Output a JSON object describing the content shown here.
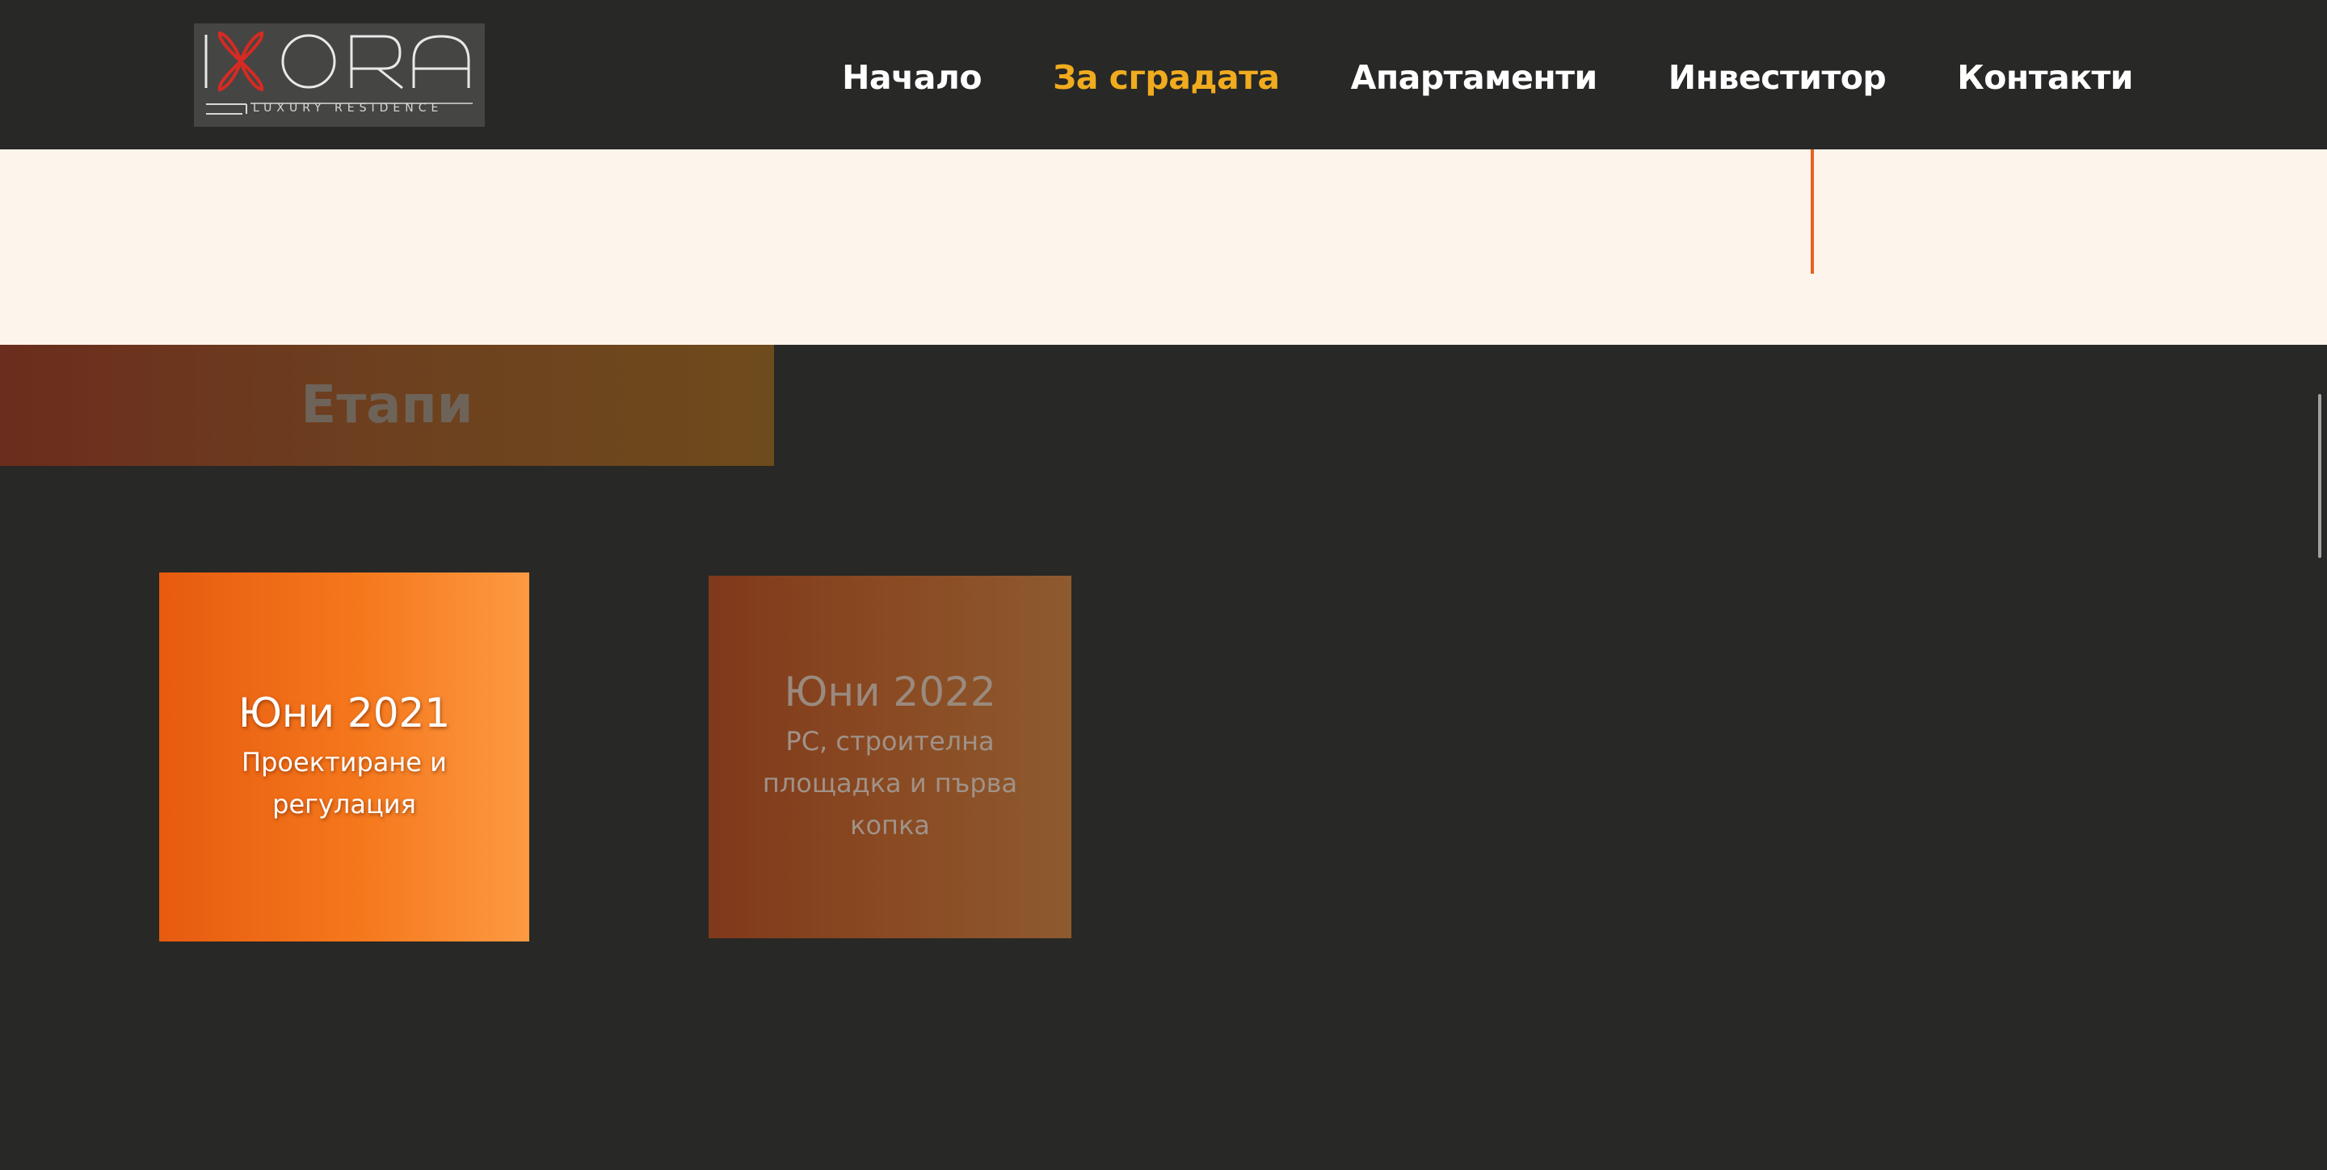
{
  "header": {
    "logo": {
      "wordmark": "IXORA",
      "tagline": "LUXURY RESIDENCE"
    },
    "nav": [
      {
        "label": "Начало",
        "active": false
      },
      {
        "label": "За сградата",
        "active": true
      },
      {
        "label": "Апартаменти",
        "active": false
      },
      {
        "label": "Инвеститор",
        "active": false
      },
      {
        "label": "Контакти",
        "active": false
      }
    ]
  },
  "stages": {
    "title": "Етапи",
    "items": [
      {
        "date": "Юни 2021",
        "description": "Проектиране и регулация"
      },
      {
        "date": "Юни 2022",
        "description": "РС, строителна площадка и първа копка"
      }
    ]
  },
  "colors": {
    "background": "#282826",
    "accent_active_nav": "#f0ac1e",
    "cream_band": "#fdf4eb",
    "accent_line": "#e8621e"
  }
}
